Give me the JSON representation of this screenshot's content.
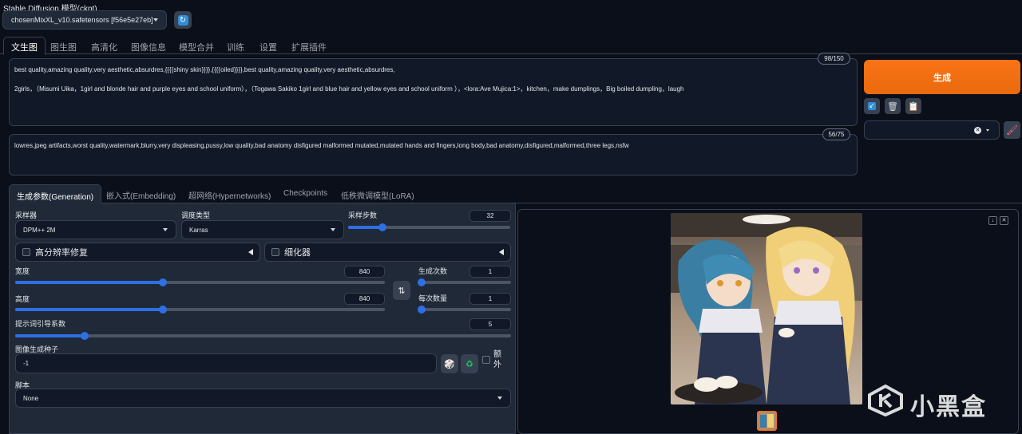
{
  "model": {
    "label": "Stable Diffusion 模型(ckpt)",
    "selected": "chosenMixXL_v10.safetensors [f56e5e27eb]"
  },
  "tabs": [
    "文生图",
    "图生图",
    "高清化",
    "图像信息",
    "模型合并",
    "训练",
    "设置",
    "扩展插件"
  ],
  "prompt": {
    "line1": "best quality,amazing quality,very aesthetic,absurdres,{{{{shiny skin}}}},{{{{oiled}}}},best quality,amazing quality,very aesthetic,absurdres,",
    "line2": "2girls，（Misumi Uika，1girl  and blonde hair  and purple eyes  and school uniform），（Togawa Sakiko 1girl and blue hair and yellow eyes and school uniform ），<lora:Ave Mujica:1>，kitchen，make dumplings，Big boiled dumpling，laugh",
    "token_count": "98/150"
  },
  "negative_prompt": {
    "text": "lowres,jpeg artifacts,worst quality,watermark,blurry,very displeasing,pussy,low quality,bad anatomy disfigured malformed mutated,mutated hands and fingers,long body,bad anatomy,disfigured,malformed,three legs,nsfw",
    "token_count": "56/75"
  },
  "generate_label": "生成",
  "sub_tabs": [
    "生成参数(Generation)",
    "嵌入式(Embedding)",
    "超网络(Hypernetworks)",
    "Checkpoints",
    "低秩微调模型(LoRA)"
  ],
  "params": {
    "sampler_label": "采样器",
    "sampler_value": "DPM++ 2M",
    "schedule_label": "调度类型",
    "schedule_value": "Karras",
    "steps_label": "采样步数",
    "steps_value": "32",
    "steps_fraction": 0.21,
    "hires_label": "高分辨率修复",
    "refiner_label": "细化器",
    "width_label": "宽度",
    "width_value": "840",
    "width_fraction": 0.4,
    "height_label": "高度",
    "height_value": "840",
    "height_fraction": 0.4,
    "batch_count_label": "生成次数",
    "batch_count_value": "1",
    "batch_size_label": "每次数量",
    "batch_size_value": "1",
    "cfg_label": "提示词引导系数",
    "cfg_value": "5",
    "cfg_fraction": 0.14,
    "seed_label": "图像生成种子",
    "seed_value": "-1",
    "extra_label": "额外",
    "script_label": "脚本",
    "script_value": "None"
  },
  "watermark": "小黑盒",
  "colors": {
    "accent": "#f97316",
    "slider": "#2f6fe4",
    "background": "#0b0f19",
    "panel": "#1f2937"
  }
}
